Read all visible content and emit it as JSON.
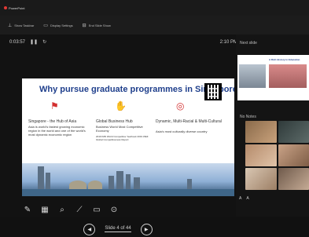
{
  "window": {
    "title": "PowerPoint"
  },
  "toolbar": {
    "items": [
      {
        "label": "Show Taskbar",
        "icon": "taskbar-icon"
      },
      {
        "label": "Display Settings",
        "icon": "display-icon"
      },
      {
        "label": "End Slide Show",
        "icon": "end-show-icon"
      }
    ]
  },
  "presenter": {
    "timer": "0:03:57",
    "clock": "2:10 PM",
    "slide_counter": "Slide 4 of 44",
    "next_label": "Next slide",
    "notes_label": "No Notes"
  },
  "slide": {
    "title": "Why pursue graduate programmes in Singapore?",
    "col1_head": "Singapore - the Hub of Asia",
    "col1_text": "Asia is world's fastest growing economic region in the world and one of the world's most dynamic economic region",
    "col2_head": "Global Business Hub",
    "col2_text": "Business World Most Competitive Economy",
    "col2_note": "2019 IMD World Competitive Yearbook 2019 WEF Global Competitiveness Report",
    "col3_head": "Dynamic, Multi-Racial & Multi-Cultural",
    "col3_text": "Asia's most culturally diverse country"
  },
  "next_slide": {
    "title": "A Rich History in Education"
  },
  "footer": {
    "zoom_out": "A",
    "zoom_in": "A"
  }
}
